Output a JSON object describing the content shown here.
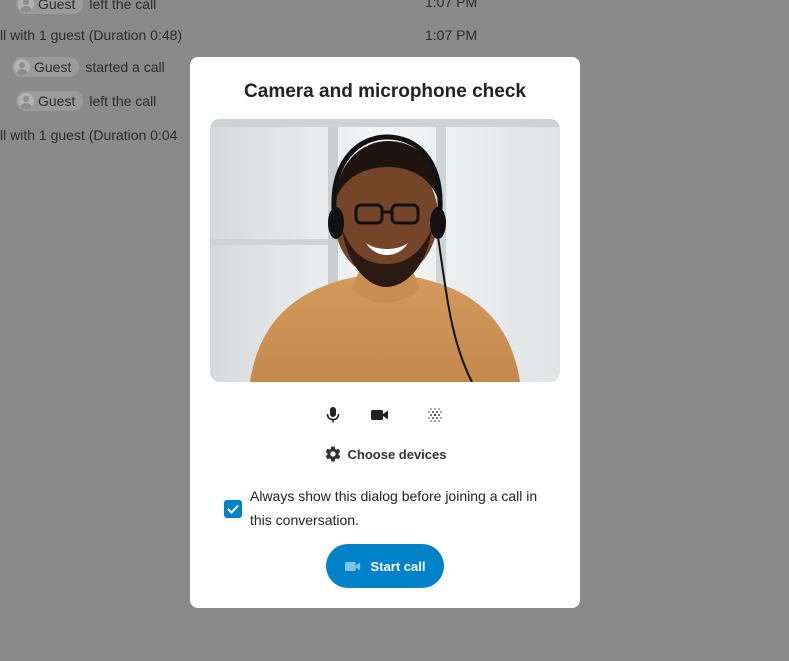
{
  "chat": {
    "rows": [
      {
        "actor": "Guest",
        "text": "left the call",
        "time": "1:07 PM"
      },
      {
        "actor": "",
        "text": "ll with 1 guest (Duration 0:48)",
        "time": "1:07 PM"
      },
      {
        "actor": "Guest",
        "text": "started a call",
        "time": ""
      },
      {
        "actor": "Guest",
        "text": "left the call",
        "time": ""
      },
      {
        "actor": "",
        "text": "ll with 1 guest (Duration 0:04",
        "time": ""
      }
    ]
  },
  "dialog": {
    "title": "Camera and microphone check",
    "controls": {
      "mic_icon": "microphone-icon",
      "camera_icon": "video-camera-icon",
      "blur_icon": "background-blur-icon"
    },
    "choose_devices_label": "Choose devices",
    "always_show_label": "Always show this dialog before joining a call in this conversation.",
    "always_show_checked": true,
    "start_call_label": "Start call"
  },
  "colors": {
    "accent": "#0082c9",
    "overlay": "#7f7f7f",
    "modal_bg": "#ffffff"
  }
}
